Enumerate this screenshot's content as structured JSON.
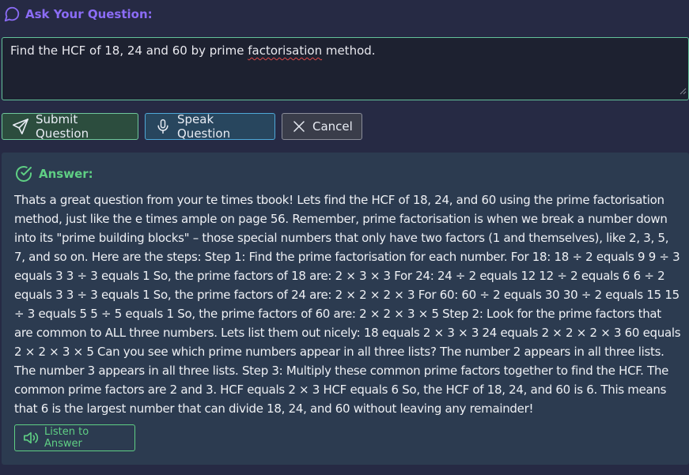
{
  "question": {
    "header": "Ask Your Question:",
    "text_before": "Find the HCF of 18, 24 and 60 by prime ",
    "text_misspelled": "factorisation",
    "text_after": " method."
  },
  "buttons": {
    "submit": "Submit Question",
    "speak": "Speak Question",
    "cancel": "Cancel"
  },
  "answer": {
    "header": "Answer:",
    "body": "Thats a great question from your te times tbook! Lets find the HCF of 18, 24, and 60 using the prime factorisation method, just like the e times ample on page 56. Remember, prime factorisation is when we break a number down into its \"prime building blocks\" – those special numbers that only have two factors (1 and themselves), like 2, 3, 5, 7, and so on. Here are the steps: Step 1: Find the prime factorisation for each number. For 18: 18 ÷ 2 equals 9 9 ÷ 3 equals 3 3 ÷ 3 equals 1 So, the prime factors of 18 are: 2 × 3 × 3 For 24: 24 ÷ 2 equals 12 12 ÷ 2 equals 6 6 ÷ 2 equals 3 3 ÷ 3 equals 1 So, the prime factors of 24 are: 2 × 2 × 2 × 3 For 60: 60 ÷ 2 equals 30 30 ÷ 2 equals 15 15 ÷ 3 equals 5 5 ÷ 5 equals 1 So, the prime factors of 60 are: 2 × 2 × 3 × 5 Step 2: Look for the prime factors that are common to ALL three numbers. Lets list them out nicely: 18 equals 2 × 3 × 3 24 equals 2 × 2 × 2 × 3 60 equals 2 × 2 × 3 × 5 Can you see which prime numbers appear in all three lists? The number 2 appears in all three lists. The number 3 appears in all three lists. Step 3: Multiply these common prime factors together to find the HCF. The common prime factors are 2 and 3. HCF equals 2 × 3 HCF equals 6 So, the HCF of 18, 24, and 60 is 6. This means that 6 is the largest number that can divide 18, 24, and 60 without leaving any remainder!",
    "listen_label": "Listen to Answer"
  },
  "icons": {
    "question": "chat-bubble-icon",
    "submit": "send-icon",
    "speak": "microphone-icon",
    "cancel": "close-icon",
    "answer": "check-circle-icon",
    "listen": "speaker-icon"
  },
  "colors": {
    "background": "#262a44",
    "question_accent": "#8b6cf6",
    "answer_accent": "#5fcf84",
    "answer_panel": "#2c3b50",
    "input_border": "#63c29a",
    "speak_border": "#4fa8d8"
  }
}
